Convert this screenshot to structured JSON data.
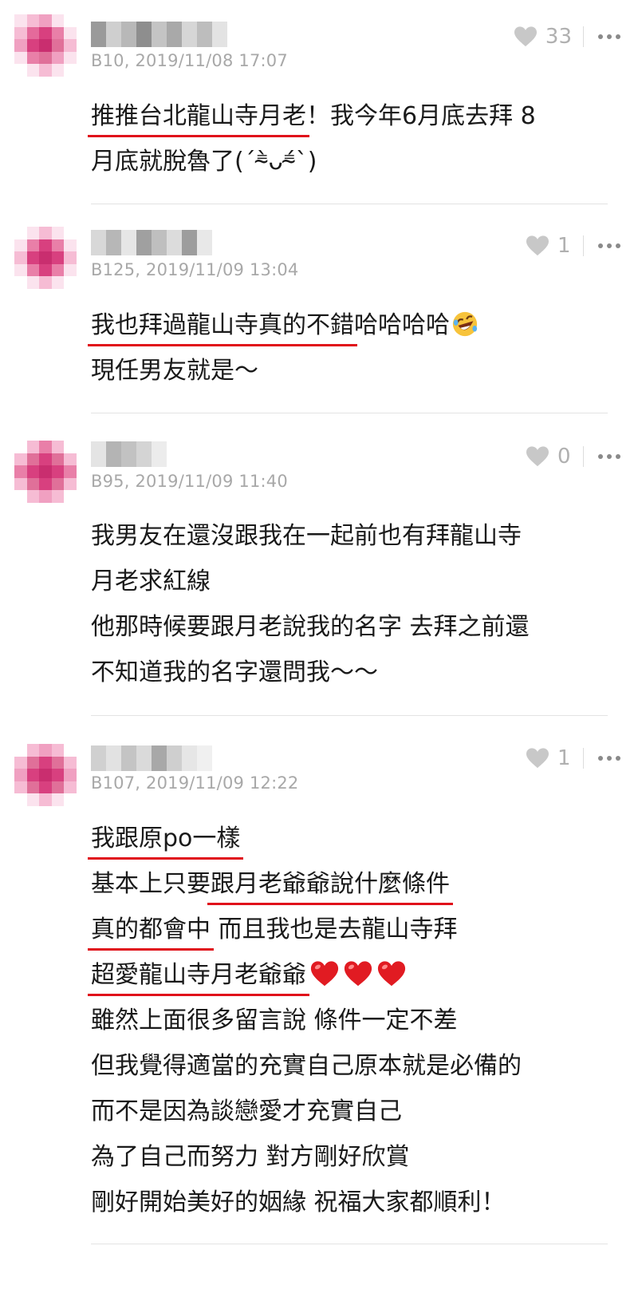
{
  "colors": {
    "underline": "#e0101a",
    "heart_like": "#c8c8c8",
    "heart_emoji": "#e11b22",
    "meta_text": "#a8a8a8"
  },
  "comments": [
    {
      "meta": "B10, 2019/11/08 17:07",
      "likes": "33",
      "lines": [
        {
          "segments": [
            {
              "u": "推推台北龍山寺月老"
            },
            {
              "t": "！我今年6月底去拜 8"
            }
          ]
        },
        {
          "segments": [
            {
              "t": "月底就脫魯了(ˊ⁼̴̀ᴗ⁼̴́ˋ)"
            }
          ]
        }
      ]
    },
    {
      "meta": "B125, 2019/11/09 13:04",
      "likes": "1",
      "lines": [
        {
          "segments": [
            {
              "u": "我也拜過龍山寺真的不錯"
            },
            {
              "t": "哈哈哈哈"
            }
          ],
          "emoji": "rolling-laughing"
        },
        {
          "segments": [
            {
              "t": "現任男友就是～"
            }
          ]
        }
      ]
    },
    {
      "meta": "B95, 2019/11/09 11:40",
      "likes": "0",
      "lines": [
        {
          "segments": [
            {
              "t": "我男友在還沒跟我在一起前也有拜龍山寺"
            }
          ]
        },
        {
          "segments": [
            {
              "t": "月老求紅線"
            }
          ]
        },
        {
          "segments": [
            {
              "t": "他那時候要跟月老說我的名字 去拜之前還"
            }
          ]
        },
        {
          "segments": [
            {
              "t": "不知道我的名字還問我～～"
            }
          ]
        }
      ]
    },
    {
      "meta": "B107, 2019/11/09 12:22",
      "likes": "1",
      "lines": [
        {
          "segments": [
            {
              "u": "我跟原po一樣"
            }
          ]
        },
        {
          "segments": [
            {
              "t": "基本上只要"
            },
            {
              "u": "跟月老爺爺說什麼條件"
            }
          ]
        },
        {
          "segments": [
            {
              "u": "真的都會中"
            },
            {
              "t": " 而且我也是去龍山寺拜"
            }
          ]
        },
        {
          "segments": [
            {
              "u": "超愛龍山寺月老爺爺"
            }
          ],
          "emoji": "three-red-hearts"
        },
        {
          "segments": [
            {
              "t": "雖然上面很多留言說 條件一定不差"
            }
          ]
        },
        {
          "segments": [
            {
              "t": "但我覺得適當的充實自己原本就是必備的"
            }
          ]
        },
        {
          "segments": [
            {
              "t": "而不是因為談戀愛才充實自己"
            }
          ]
        },
        {
          "segments": [
            {
              "t": "為了自己而努力 對方剛好欣賞"
            }
          ]
        },
        {
          "segments": [
            {
              "t": "剛好開始美好的姻緣 祝福大家都順利！"
            }
          ]
        }
      ]
    }
  ]
}
